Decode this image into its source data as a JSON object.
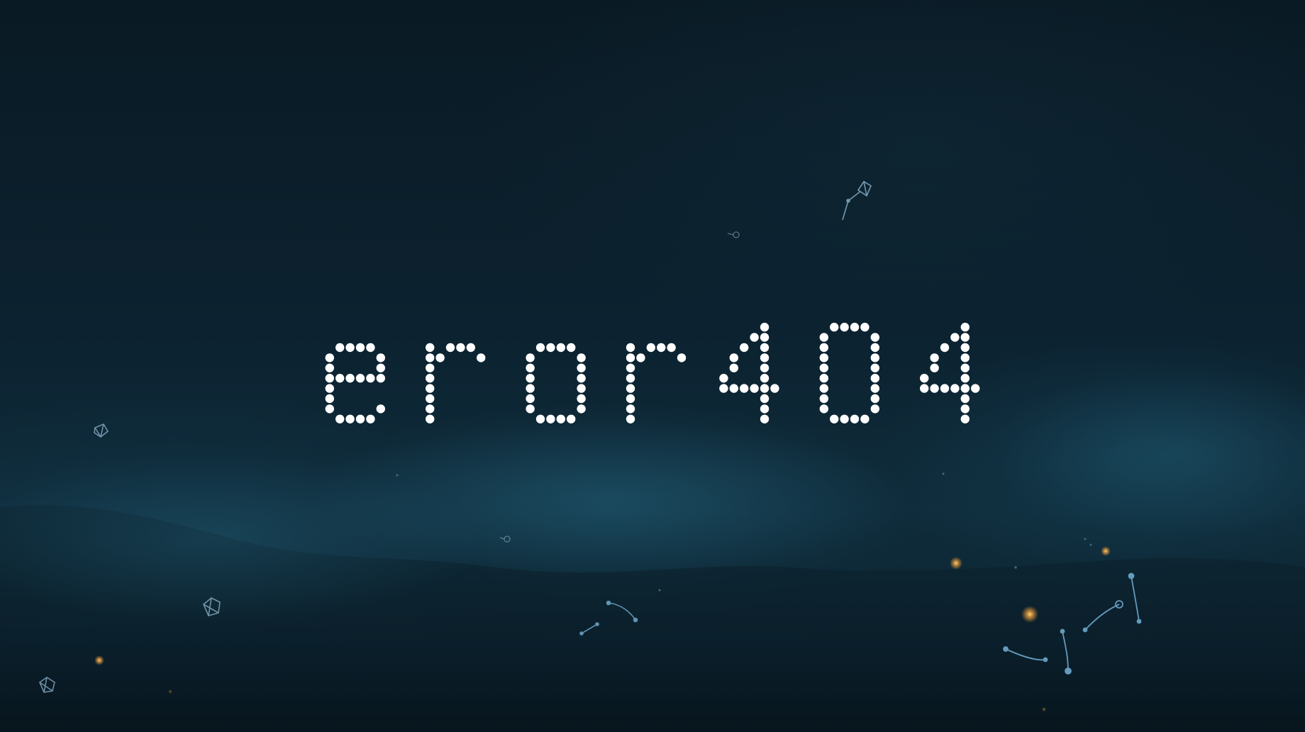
{
  "page": {
    "heading": "eror 404"
  },
  "colors": {
    "background": "#0b1f2b",
    "dot_text": "#ffffff",
    "constellation": "#7fb3d5",
    "ember": "#ffb347"
  },
  "icons": [
    "cube-outline-icon",
    "constellation-icon",
    "ember-particle-icon"
  ]
}
